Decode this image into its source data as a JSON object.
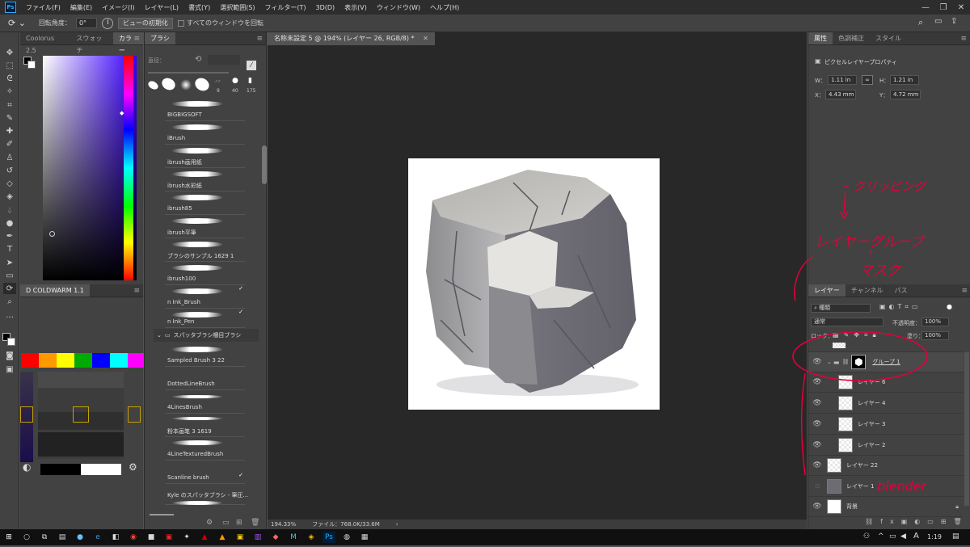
{
  "app": {
    "logo": "Ps"
  },
  "menubar": {
    "items": [
      "ファイル(F)",
      "編集(E)",
      "イメージ(I)",
      "レイヤー(L)",
      "書式(Y)",
      "選択範囲(S)",
      "フィルター(T)",
      "3D(D)",
      "表示(V)",
      "ウィンドウ(W)",
      "ヘルプ(H)"
    ]
  },
  "window_controls": {
    "minimize": "—",
    "restore": "❐",
    "close": "✕"
  },
  "options": {
    "rotation_label": "回転角度：",
    "rotation_value": "0°",
    "reset_view": "ビューの初期化",
    "rotate_all": "すべてのウィンドウを回転"
  },
  "color_panel": {
    "tabs": [
      "Coolorus 2.5",
      "スウォッチ",
      "カラー"
    ]
  },
  "coldwarm_panel": {
    "title": "D COLDWARM 1.1",
    "swatches": [
      "#ff0000",
      "#ff9900",
      "#ffff00",
      "#00aa00",
      "#0000ff",
      "#00ffff",
      "#ff00ff"
    ]
  },
  "brush_panel": {
    "tab": "ブラシ",
    "size_label": "直径：",
    "preset_sizes": [
      "9",
      "40",
      "175"
    ],
    "brushes": [
      "BIGBIGSOFT",
      "iBrush",
      "ibrush画用紙",
      "ibrush水彩紙",
      "ibrush85",
      "ibrush平筆",
      "ブラシのサンプル 1629 1",
      "ibrush100",
      "n Ink_Brush",
      "n Ink_Pen"
    ],
    "group_name": "スパッタブラシ柵目ブラシ",
    "group_brushes": [
      "Sampled Brush 3 22",
      "DottedLineBrush",
      "4LinesBrush",
      "粉本画笔 3 1619",
      "4LineTexturedBrush",
      "Scanline brush",
      "Kyle のスパッタブラシ - 筆圧..."
    ]
  },
  "document": {
    "tab_title": "名称未設定 5 @ 194% (レイヤー 26, RGB/8) *",
    "close": "✕"
  },
  "status": {
    "zoom": "194.33%",
    "file_info": "ファイル：768.0K/33.6M",
    "arrow": "›"
  },
  "properties": {
    "tabs": [
      "属性",
      "色調補正",
      "スタイル"
    ],
    "title": "ピクセルレイヤープロパティ",
    "w_label": "W：",
    "w_value": "1.11 in",
    "h_label": "H：",
    "h_value": "1.21 in",
    "x_label": "X：",
    "x_value": "4.43 mm",
    "y_label": "Y：",
    "y_value": "4.72 mm"
  },
  "layers_panel": {
    "tabs": [
      "レイヤー",
      "チャンネル",
      "パス"
    ],
    "filter_label": "種類",
    "blend_mode": "通常",
    "opacity_label": "不透明度：",
    "opacity_value": "100%",
    "lock_label": "ロック：",
    "fill_label": "塗り：",
    "fill_value": "100%",
    "layers": [
      {
        "name": "グループ 1",
        "type": "group"
      },
      {
        "name": "レイヤー 6",
        "type": "clip"
      },
      {
        "name": "レイヤー 4",
        "type": "clip"
      },
      {
        "name": "レイヤー 3",
        "type": "clip"
      },
      {
        "name": "レイヤー 2",
        "type": "clip"
      },
      {
        "name": "レイヤー 22",
        "type": "layer"
      },
      {
        "name": "レイヤー 1",
        "type": "layer"
      },
      {
        "name": "背景",
        "type": "background"
      }
    ]
  },
  "annotations": {
    "clipping": "クリッピング",
    "layer_group": "レイヤーグループ",
    "plus": "+",
    "mask": "マスク",
    "blender": "blender"
  },
  "taskbar": {
    "time": "1:19",
    "ime": "A"
  },
  "colors": {
    "annotation": "#e3003b",
    "accent": "#31a8ff"
  }
}
